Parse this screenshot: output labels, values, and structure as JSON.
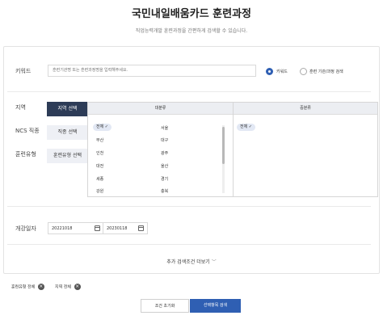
{
  "header": {
    "title": "국민내일배움카드 훈련과정",
    "subtitle": "직업능력개발 훈련과정을 간편하게 검색할 수 있습니다."
  },
  "keyword": {
    "label": "키워드",
    "placeholder": "훈련기관명 또는 훈련과정명을 입력해주세요.",
    "radio_options": [
      "키워드",
      "훈련 기관/과정 검색"
    ],
    "selected_option": "키워드"
  },
  "region_labels": {
    "region": "지역",
    "ncs": "NCS 직종",
    "training_type": "훈련유형"
  },
  "side_tabs": [
    "지역 선택",
    "직종 선택",
    "훈련유형 선택"
  ],
  "region_selector": {
    "col_major": "대분류",
    "col_minor": "중분류",
    "major_left": [
      "전체",
      "부산",
      "인천",
      "대전",
      "세종",
      "강원"
    ],
    "major_right": [
      "서울",
      "대구",
      "광주",
      "울산",
      "경기",
      "충북"
    ],
    "minor": [
      "전체"
    ]
  },
  "period": {
    "label": "개강일자",
    "start": "20221018",
    "separator": "~",
    "end": "20230118"
  },
  "more_filters": "추가 검색조건 더보기",
  "applied_filters": [
    "훈련유형 전체",
    "지역 전체"
  ],
  "buttons": {
    "reset": "조건 초기화",
    "search": "선택항목 검색"
  },
  "colors": {
    "accent": "#2f5fb3",
    "active_tab": "#2d3c57"
  }
}
